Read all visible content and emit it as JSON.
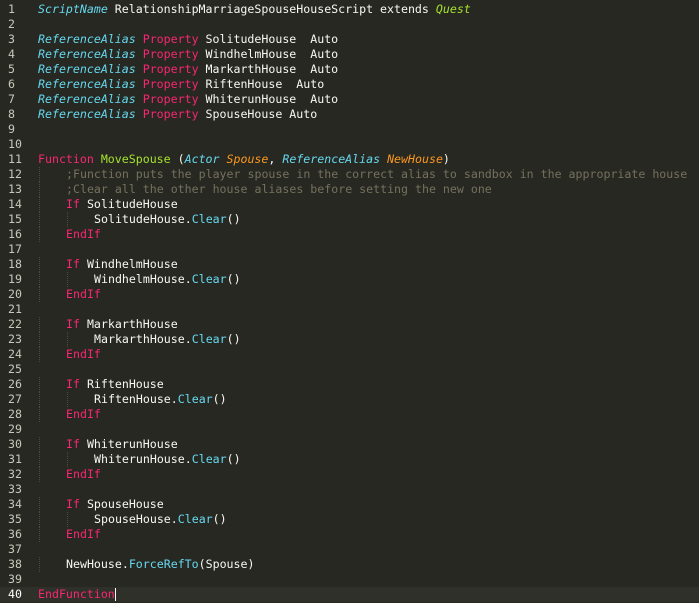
{
  "theme": {
    "background": "#272822",
    "text": "#f8f8f2",
    "gutter_text": "#c8c8bc",
    "keyword": "#f92672",
    "type": "#66d9ef",
    "function_name": "#a6e22e",
    "parameter": "#fd971f",
    "comment": "#75715e"
  },
  "editor": {
    "active_line": 40,
    "lines": [
      {
        "num": "1",
        "indent": 0,
        "tokens": [
          {
            "t": "ScriptName",
            "c": "ty"
          },
          {
            "t": " RelationshipMarriageSpouseHouseScript extends ",
            "c": "tx"
          },
          {
            "t": "Quest",
            "c": "quest"
          }
        ]
      },
      {
        "num": "2",
        "indent": 0,
        "tokens": []
      },
      {
        "num": "3",
        "indent": 0,
        "tokens": [
          {
            "t": "ReferenceAlias",
            "c": "ty"
          },
          {
            "t": " ",
            "c": "tx"
          },
          {
            "t": "Property",
            "c": "kw"
          },
          {
            "t": " SolitudeHouse  Auto",
            "c": "tx"
          }
        ]
      },
      {
        "num": "4",
        "indent": 0,
        "tokens": [
          {
            "t": "ReferenceAlias",
            "c": "ty"
          },
          {
            "t": " ",
            "c": "tx"
          },
          {
            "t": "Property",
            "c": "kw"
          },
          {
            "t": " WindhelmHouse  Auto",
            "c": "tx"
          }
        ]
      },
      {
        "num": "5",
        "indent": 0,
        "tokens": [
          {
            "t": "ReferenceAlias",
            "c": "ty"
          },
          {
            "t": " ",
            "c": "tx"
          },
          {
            "t": "Property",
            "c": "kw"
          },
          {
            "t": " MarkarthHouse  Auto",
            "c": "tx"
          }
        ]
      },
      {
        "num": "6",
        "indent": 0,
        "tokens": [
          {
            "t": "ReferenceAlias",
            "c": "ty"
          },
          {
            "t": " ",
            "c": "tx"
          },
          {
            "t": "Property",
            "c": "kw"
          },
          {
            "t": " RiftenHouse  Auto",
            "c": "tx"
          }
        ]
      },
      {
        "num": "7",
        "indent": 0,
        "tokens": [
          {
            "t": "ReferenceAlias",
            "c": "ty"
          },
          {
            "t": " ",
            "c": "tx"
          },
          {
            "t": "Property",
            "c": "kw"
          },
          {
            "t": " WhiterunHouse  Auto",
            "c": "tx"
          }
        ]
      },
      {
        "num": "8",
        "indent": 0,
        "tokens": [
          {
            "t": "ReferenceAlias",
            "c": "ty"
          },
          {
            "t": " ",
            "c": "tx"
          },
          {
            "t": "Property",
            "c": "kw"
          },
          {
            "t": " SpouseHouse Auto",
            "c": "tx"
          }
        ]
      },
      {
        "num": "9",
        "indent": 0,
        "tokens": []
      },
      {
        "num": "10",
        "indent": 0,
        "tokens": []
      },
      {
        "num": "11",
        "indent": 0,
        "tokens": [
          {
            "t": "Function",
            "c": "kw"
          },
          {
            "t": " ",
            "c": "tx"
          },
          {
            "t": "MoveSpouse",
            "c": "fn"
          },
          {
            "t": " (",
            "c": "tx"
          },
          {
            "t": "Actor",
            "c": "ty"
          },
          {
            "t": " ",
            "c": "tx"
          },
          {
            "t": "Spouse",
            "c": "param"
          },
          {
            "t": ", ",
            "c": "tx"
          },
          {
            "t": "ReferenceAlias",
            "c": "ty"
          },
          {
            "t": " ",
            "c": "tx"
          },
          {
            "t": "NewHouse",
            "c": "param"
          },
          {
            "t": ")",
            "c": "tx"
          }
        ]
      },
      {
        "num": "12",
        "indent": 1,
        "tokens": [
          {
            "t": ";Function puts the player spouse in the correct alias to sandbox in the appropriate house",
            "c": "cm"
          }
        ]
      },
      {
        "num": "13",
        "indent": 1,
        "tokens": [
          {
            "t": ";Clear all the other house aliases before setting the new one",
            "c": "cm"
          }
        ]
      },
      {
        "num": "14",
        "indent": 1,
        "tokens": [
          {
            "t": "If",
            "c": "kw"
          },
          {
            "t": " SolitudeHouse",
            "c": "tx"
          }
        ]
      },
      {
        "num": "15",
        "indent": 2,
        "tokens": [
          {
            "t": "SolitudeHouse.",
            "c": "tx"
          },
          {
            "t": "Clear",
            "c": "method"
          },
          {
            "t": "()",
            "c": "tx"
          }
        ]
      },
      {
        "num": "16",
        "indent": 1,
        "tokens": [
          {
            "t": "EndIf",
            "c": "kw"
          }
        ]
      },
      {
        "num": "17",
        "indent": 0,
        "tokens": []
      },
      {
        "num": "18",
        "indent": 1,
        "tokens": [
          {
            "t": "If",
            "c": "kw"
          },
          {
            "t": " WindhelmHouse",
            "c": "tx"
          }
        ]
      },
      {
        "num": "19",
        "indent": 2,
        "tokens": [
          {
            "t": "WindhelmHouse.",
            "c": "tx"
          },
          {
            "t": "Clear",
            "c": "method"
          },
          {
            "t": "()",
            "c": "tx"
          }
        ]
      },
      {
        "num": "20",
        "indent": 1,
        "tokens": [
          {
            "t": "EndIf",
            "c": "kw"
          }
        ]
      },
      {
        "num": "21",
        "indent": 0,
        "tokens": []
      },
      {
        "num": "22",
        "indent": 1,
        "tokens": [
          {
            "t": "If",
            "c": "kw"
          },
          {
            "t": " MarkarthHouse",
            "c": "tx"
          }
        ]
      },
      {
        "num": "23",
        "indent": 2,
        "tokens": [
          {
            "t": "MarkarthHouse.",
            "c": "tx"
          },
          {
            "t": "Clear",
            "c": "method"
          },
          {
            "t": "()",
            "c": "tx"
          }
        ]
      },
      {
        "num": "24",
        "indent": 1,
        "tokens": [
          {
            "t": "EndIf",
            "c": "kw"
          }
        ]
      },
      {
        "num": "25",
        "indent": 0,
        "tokens": []
      },
      {
        "num": "26",
        "indent": 1,
        "tokens": [
          {
            "t": "If",
            "c": "kw"
          },
          {
            "t": " RiftenHouse",
            "c": "tx"
          }
        ]
      },
      {
        "num": "27",
        "indent": 2,
        "tokens": [
          {
            "t": "RiftenHouse.",
            "c": "tx"
          },
          {
            "t": "Clear",
            "c": "method"
          },
          {
            "t": "()",
            "c": "tx"
          }
        ]
      },
      {
        "num": "28",
        "indent": 1,
        "tokens": [
          {
            "t": "EndIf",
            "c": "kw"
          }
        ]
      },
      {
        "num": "29",
        "indent": 0,
        "tokens": []
      },
      {
        "num": "30",
        "indent": 1,
        "tokens": [
          {
            "t": "If",
            "c": "kw"
          },
          {
            "t": " WhiterunHouse",
            "c": "tx"
          }
        ]
      },
      {
        "num": "31",
        "indent": 2,
        "tokens": [
          {
            "t": "WhiterunHouse.",
            "c": "tx"
          },
          {
            "t": "Clear",
            "c": "method"
          },
          {
            "t": "()",
            "c": "tx"
          }
        ]
      },
      {
        "num": "32",
        "indent": 1,
        "tokens": [
          {
            "t": "EndIf",
            "c": "kw"
          }
        ]
      },
      {
        "num": "33",
        "indent": 0,
        "tokens": []
      },
      {
        "num": "34",
        "indent": 1,
        "tokens": [
          {
            "t": "If",
            "c": "kw"
          },
          {
            "t": " SpouseHouse",
            "c": "tx"
          }
        ]
      },
      {
        "num": "35",
        "indent": 2,
        "tokens": [
          {
            "t": "SpouseHouse.",
            "c": "tx"
          },
          {
            "t": "Clear",
            "c": "method"
          },
          {
            "t": "()",
            "c": "tx"
          }
        ]
      },
      {
        "num": "36",
        "indent": 1,
        "tokens": [
          {
            "t": "EndIf",
            "c": "kw"
          }
        ]
      },
      {
        "num": "37",
        "indent": 0,
        "tokens": []
      },
      {
        "num": "38",
        "indent": 1,
        "tokens": [
          {
            "t": "NewHouse.",
            "c": "tx"
          },
          {
            "t": "ForceRefTo",
            "c": "method"
          },
          {
            "t": "(Spouse)",
            "c": "tx"
          }
        ]
      },
      {
        "num": "39",
        "indent": 0,
        "tokens": []
      },
      {
        "num": "40",
        "indent": 0,
        "tokens": [
          {
            "t": "EndFunction",
            "c": "kw"
          }
        ]
      }
    ]
  }
}
